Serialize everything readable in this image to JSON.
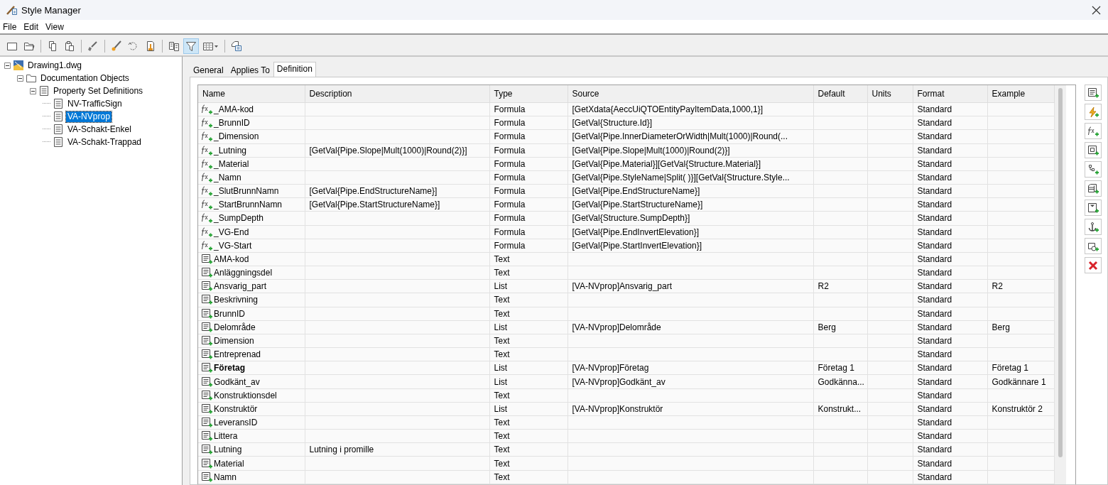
{
  "window": {
    "title": "Style Manager"
  },
  "menu": [
    "File",
    "Edit",
    "View"
  ],
  "toolbar": [
    [
      {
        "kind": "new",
        "pressed": false
      },
      {
        "kind": "open",
        "pressed": false
      }
    ],
    [
      {
        "kind": "copy",
        "pressed": false
      },
      {
        "kind": "paste",
        "pressed": false
      }
    ],
    [
      {
        "kind": "purge",
        "pressed": false
      }
    ],
    [
      {
        "kind": "edit",
        "pressed": false
      },
      {
        "kind": "sync",
        "pressed": false
      },
      {
        "kind": "clean",
        "pressed": false
      }
    ],
    [
      {
        "kind": "compare",
        "pressed": false
      },
      {
        "kind": "filter",
        "pressed": true
      },
      {
        "kind": "view",
        "pressed": false
      }
    ],
    [
      {
        "kind": "toggle",
        "pressed": false
      }
    ]
  ],
  "tree": [
    {
      "label": "Drawing1.dwg",
      "kind": "drawing",
      "expanded": true,
      "selected": false,
      "children": [
        {
          "label": "Documentation Objects",
          "kind": "folder",
          "expanded": true,
          "selected": false,
          "children": [
            {
              "label": "Property Set Definitions",
              "kind": "set",
              "expanded": true,
              "selected": false,
              "children": [
                {
                  "label": "NV-TrafficSign",
                  "kind": "set",
                  "selected": false
                },
                {
                  "label": "VA-NVprop",
                  "kind": "set",
                  "selected": true
                },
                {
                  "label": "VA-Schakt-Enkel",
                  "kind": "set",
                  "selected": false
                },
                {
                  "label": "VA-Schakt-Trappad",
                  "kind": "set",
                  "selected": false
                }
              ]
            }
          ]
        }
      ]
    }
  ],
  "tabs": [
    {
      "label": "General",
      "selected": false
    },
    {
      "label": "Applies To",
      "selected": false
    },
    {
      "label": "Definition",
      "selected": true
    }
  ],
  "table": {
    "columns": [
      "Name",
      "Description",
      "Type",
      "Source",
      "Default",
      "Units",
      "Format",
      "Example"
    ],
    "rows": [
      {
        "kind": "formula",
        "bold": false,
        "name": "_AMA-kod",
        "type": "Formula",
        "source": "[GetXdata{AeccUiQTOEntityPayItemData,1000,1}]",
        "format": "Standard"
      },
      {
        "kind": "formula",
        "bold": false,
        "name": "_BrunnID",
        "type": "Formula",
        "source": "[GetVal{Structure.Id}]",
        "format": "Standard"
      },
      {
        "kind": "formula",
        "bold": false,
        "name": "_Dimension",
        "type": "Formula",
        "source": "[GetVal{Pipe.InnerDiameterOrWidth|Mult(1000)|Round(...",
        "format": "Standard"
      },
      {
        "kind": "formula",
        "bold": false,
        "name": "_Lutning",
        "description": "[GetVal{Pipe.Slope|Mult(1000)|Round(2)}]",
        "type": "Formula",
        "source": "[GetVal{Pipe.Slope|Mult(1000)|Round(2)}]",
        "format": "Standard"
      },
      {
        "kind": "formula",
        "bold": false,
        "name": "_Material",
        "type": "Formula",
        "source": "[GetVal{Pipe.Material}][GetVal{Structure.Material}]",
        "format": "Standard"
      },
      {
        "kind": "formula",
        "bold": false,
        "name": "_Namn",
        "type": "Formula",
        "source": "[GetVal{Pipe.StyleName|Split( )}][GetVal{Structure.Style...",
        "format": "Standard"
      },
      {
        "kind": "formula",
        "bold": false,
        "name": "_SlutBrunnNamn",
        "description": "[GetVal{Pipe.EndStructureName}]",
        "type": "Formula",
        "source": "[GetVal{Pipe.EndStructureName}]",
        "format": "Standard"
      },
      {
        "kind": "formula",
        "bold": false,
        "name": "_StartBrunnNamn",
        "description": "[GetVal{Pipe.StartStructureName}]",
        "type": "Formula",
        "source": "[GetVal{Pipe.StartStructureName}]",
        "format": "Standard"
      },
      {
        "kind": "formula",
        "bold": false,
        "name": "_SumpDepth",
        "type": "Formula",
        "source": "[GetVal{Structure.SumpDepth}]",
        "format": "Standard"
      },
      {
        "kind": "formula",
        "bold": false,
        "name": "_VG-End",
        "type": "Formula",
        "source": "[GetVal{Pipe.EndInvertElevation}]",
        "format": "Standard"
      },
      {
        "kind": "formula",
        "bold": false,
        "name": "_VG-Start",
        "type": "Formula",
        "source": "[GetVal{Pipe.StartInvertElevation}]",
        "format": "Standard"
      },
      {
        "kind": "manual",
        "bold": false,
        "name": "AMA-kod",
        "type": "Text",
        "format": "Standard"
      },
      {
        "kind": "manual",
        "bold": false,
        "name": "Anläggningsdel",
        "type": "Text",
        "format": "Standard"
      },
      {
        "kind": "manual",
        "bold": false,
        "name": "Ansvarig_part",
        "type": "List",
        "source": "[VA-NVprop]Ansvarig_part",
        "default": "R2",
        "format": "Standard",
        "example": "R2"
      },
      {
        "kind": "manual",
        "bold": false,
        "name": "Beskrivning",
        "type": "Text",
        "format": "Standard"
      },
      {
        "kind": "manual",
        "bold": false,
        "name": "BrunnID",
        "type": "Text",
        "format": "Standard"
      },
      {
        "kind": "manual",
        "bold": false,
        "name": "Delområde",
        "type": "List",
        "source": "[VA-NVprop]Delområde",
        "default": "Berg",
        "format": "Standard",
        "example": "Berg"
      },
      {
        "kind": "manual",
        "bold": false,
        "name": "Dimension",
        "type": "Text",
        "format": "Standard"
      },
      {
        "kind": "manual",
        "bold": false,
        "name": "Entreprenad",
        "type": "Text",
        "format": "Standard"
      },
      {
        "kind": "manual",
        "bold": true,
        "name": "Företag",
        "type": "List",
        "source": "[VA-NVprop]Företag",
        "default": "Företag 1",
        "format": "Standard",
        "example": "Företag 1"
      },
      {
        "kind": "manual",
        "bold": false,
        "name": "Godkänt_av",
        "type": "List",
        "source": "[VA-NVprop]Godkänt_av",
        "default": "Godkänna...",
        "format": "Standard",
        "example": "Godkännare 1"
      },
      {
        "kind": "manual",
        "bold": false,
        "name": "Konstruktionsdel",
        "type": "Text",
        "format": "Standard"
      },
      {
        "kind": "manual",
        "bold": false,
        "name": "Konstruktör",
        "type": "List",
        "source": "[VA-NVprop]Konstruktör",
        "default": "Konstrukt...",
        "format": "Standard",
        "example": "Konstruktör 2"
      },
      {
        "kind": "manual",
        "bold": false,
        "name": "LeveransID",
        "type": "Text",
        "format": "Standard"
      },
      {
        "kind": "manual",
        "bold": false,
        "name": "Littera",
        "type": "Text",
        "format": "Standard"
      },
      {
        "kind": "manual",
        "bold": false,
        "name": "Lutning",
        "description": "Lutning i promille",
        "type": "Text",
        "format": "Standard"
      },
      {
        "kind": "manual",
        "bold": false,
        "name": "Material",
        "type": "Text",
        "format": "Standard"
      },
      {
        "kind": "manual",
        "bold": false,
        "name": "Namn",
        "type": "Text",
        "format": "Standard"
      }
    ]
  },
  "actions": [
    {
      "kind": "add-manual"
    },
    {
      "kind": "add-automatic"
    },
    {
      "kind": "add-formula"
    },
    {
      "kind": "add-location"
    },
    {
      "kind": "add-classification"
    },
    {
      "kind": "add-material"
    },
    {
      "kind": "add-graphic"
    },
    {
      "kind": "add-anchor"
    },
    {
      "kind": "add-query"
    },
    {
      "kind": "delete"
    }
  ]
}
